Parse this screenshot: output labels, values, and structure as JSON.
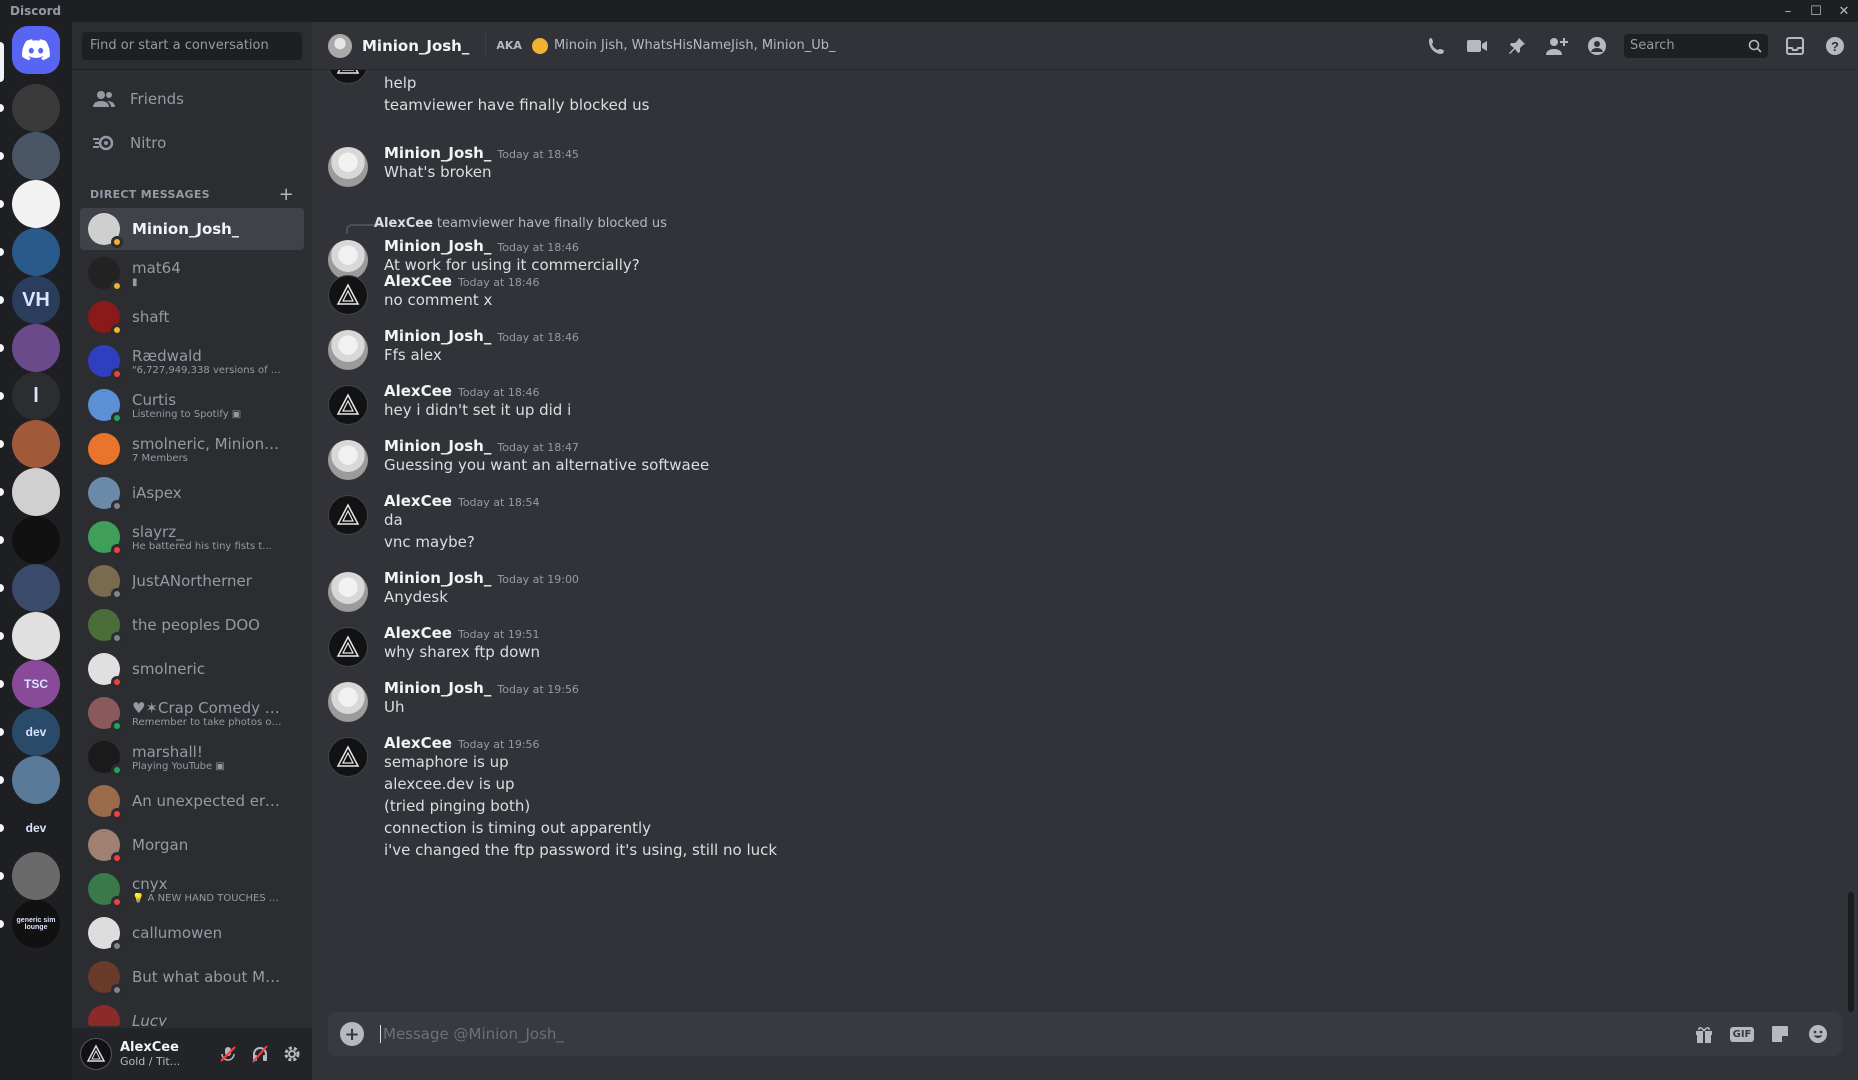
{
  "window": {
    "title": "Discord",
    "controls": [
      "–",
      "☐",
      "✕"
    ]
  },
  "sidebar": {
    "search_placeholder": "Find or start a conversation",
    "nav": [
      {
        "label": "Friends",
        "icon": "friends-icon"
      },
      {
        "label": "Nitro",
        "icon": "nitro-icon"
      }
    ],
    "dm_header": "DIRECT MESSAGES",
    "dms": [
      {
        "name": "Minion_Josh_",
        "sub": "",
        "status": "#f0b232",
        "avatar": "#cfcfcf",
        "active": true
      },
      {
        "name": "mat64",
        "sub": "▮",
        "status": "#f0b232",
        "avatar": "#222222"
      },
      {
        "name": "shaft",
        "sub": "",
        "status": "#f0b232",
        "avatar": "#8a1a1a"
      },
      {
        "name": "Rædwald",
        "sub": "\"6,727,949,338 versions of us ...",
        "status": "#f23f43",
        "avatar": "#2f3fbf"
      },
      {
        "name": "Curtis",
        "sub": "Listening to Spotify ▣",
        "status": "#23a55a",
        "avatar": "#5b8fd6"
      },
      {
        "name": "smolneric, Minion_Jo...",
        "sub": "7 Members",
        "status": "",
        "avatar": "#e8752b"
      },
      {
        "name": "iAspex",
        "sub": "",
        "status": "#80848e",
        "avatar": "#6a8aa8"
      },
      {
        "name": "slayrz_",
        "sub": "He battered his tiny fists t...",
        "status": "#f23f43",
        "avatar": "#3f9e5a"
      },
      {
        "name": "JustANortherner",
        "sub": "",
        "status": "#80848e",
        "avatar": "#7a6a50"
      },
      {
        "name": "the peoples DOO",
        "sub": "",
        "status": "#80848e",
        "avatar": "#4a6e3a"
      },
      {
        "name": "smolneric",
        "sub": "",
        "status": "#f23f43",
        "avatar": "#e0e0e0"
      },
      {
        "name": "♥✶Crap Comedy Que...",
        "sub": "Remember to take photos of t...",
        "status": "#23a55a",
        "avatar": "#8a5a5a"
      },
      {
        "name": "marshall!",
        "sub": "Playing YouTube ▣",
        "status": "#23a55a",
        "avatar": "#1a1a1a"
      },
      {
        "name": "An unexpected error ...",
        "sub": "",
        "status": "#f23f43",
        "avatar": "#9a6a4a"
      },
      {
        "name": "Morgan",
        "sub": "",
        "status": "#f23f43",
        "avatar": "#a08070"
      },
      {
        "name": "cnyx",
        "sub": "💡 A NEW HAND TOUCHES T...",
        "status": "#f23f43",
        "avatar": "#3a7a4a"
      },
      {
        "name": "callumowen",
        "sub": "",
        "status": "#80848e",
        "avatar": "#dddddd"
      },
      {
        "name": "But what about Mirab...",
        "sub": "",
        "status": "#80848e",
        "avatar": "#6a3a2a"
      },
      {
        "name": "Lucy",
        "sub": "",
        "status": "",
        "avatar": "#8a2a2a"
      }
    ],
    "user": {
      "name": "AlexCee",
      "status": "Gold / Tit..."
    }
  },
  "rail": {
    "servers": [
      {
        "label": "",
        "color": "#3a3a3a"
      },
      {
        "label": "",
        "color": "#4a5566"
      },
      {
        "label": "",
        "color": "#f2f2f2"
      },
      {
        "label": "",
        "color": "#2a5a8a"
      },
      {
        "label": "VH",
        "color": "#2b3d5c"
      },
      {
        "label": "",
        "color": "#6a4a8a"
      },
      {
        "label": "l",
        "color": "#2b2d31"
      },
      {
        "label": "",
        "color": "#a05a3a"
      },
      {
        "label": "",
        "color": "#d0d0d0"
      },
      {
        "label": "",
        "color": "#111111"
      },
      {
        "label": "",
        "color": "#3a4a6a"
      },
      {
        "label": "",
        "color": "#e0e0e0"
      },
      {
        "label": "TSC",
        "color": "#8a4a9a"
      },
      {
        "label": "dev",
        "color": "#2a4a6a"
      },
      {
        "label": "",
        "color": "#5a7a9a"
      },
      {
        "label": "dev",
        "color": "#1e1f22"
      },
      {
        "label": "",
        "color": "#6a6a6a"
      },
      {
        "label": "generic sim lounge",
        "color": "#111111"
      }
    ]
  },
  "header": {
    "name": "Minion_Josh_",
    "aka_label": "AKA",
    "aka_names": "Minoin Jish, WhatsHisNameJish, Minion_Ub_",
    "search_placeholder": "Search"
  },
  "messages": [
    {
      "author": "",
      "time": "",
      "lines": [
        "help",
        "teamviewer have finally blocked us"
      ]
    },
    {
      "author": "Minion_Josh_",
      "time": "Today at 18:45",
      "lines": [
        "What's broken"
      ]
    },
    {
      "author": "Minion_Josh_",
      "time": "Today at 18:46",
      "reply_author": "AlexCee",
      "reply_text": "teamviewer have finally blocked us",
      "lines": [
        "At work for using it commercially?"
      ]
    },
    {
      "author": "AlexCee",
      "time": "Today at 18:46",
      "lines": [
        "no comment x"
      ]
    },
    {
      "author": "Minion_Josh_",
      "time": "Today at 18:46",
      "lines": [
        "Ffs alex"
      ]
    },
    {
      "author": "AlexCee",
      "time": "Today at 18:46",
      "lines": [
        "hey i didn't set it up did i"
      ]
    },
    {
      "author": "Minion_Josh_",
      "time": "Today at 18:47",
      "lines": [
        "Guessing you want an alternative softwaee"
      ]
    },
    {
      "author": "AlexCee",
      "time": "Today at 18:54",
      "lines": [
        "da",
        "vnc maybe?"
      ]
    },
    {
      "author": "Minion_Josh_",
      "time": "Today at 19:00",
      "lines": [
        "Anydesk"
      ]
    },
    {
      "author": "AlexCee",
      "time": "Today at 19:51",
      "lines": [
        "why sharex ftp down"
      ]
    },
    {
      "author": "Minion_Josh_",
      "time": "Today at 19:56",
      "lines": [
        "Uh"
      ]
    },
    {
      "author": "AlexCee",
      "time": "Today at 19:56",
      "lines": [
        "semaphore is up",
        "alexcee.dev  is up",
        "(tried pinging both)",
        "connection is timing out apparently",
        "i've changed the ftp password it's using, still no luck"
      ]
    }
  ],
  "composer": {
    "placeholder": "Message @Minion_Josh_",
    "gif_label": "GIF"
  },
  "colors": {
    "accent": "#5865f2",
    "online": "#23a55a",
    "idle": "#f0b232",
    "dnd": "#f23f43",
    "offline": "#80848e"
  }
}
